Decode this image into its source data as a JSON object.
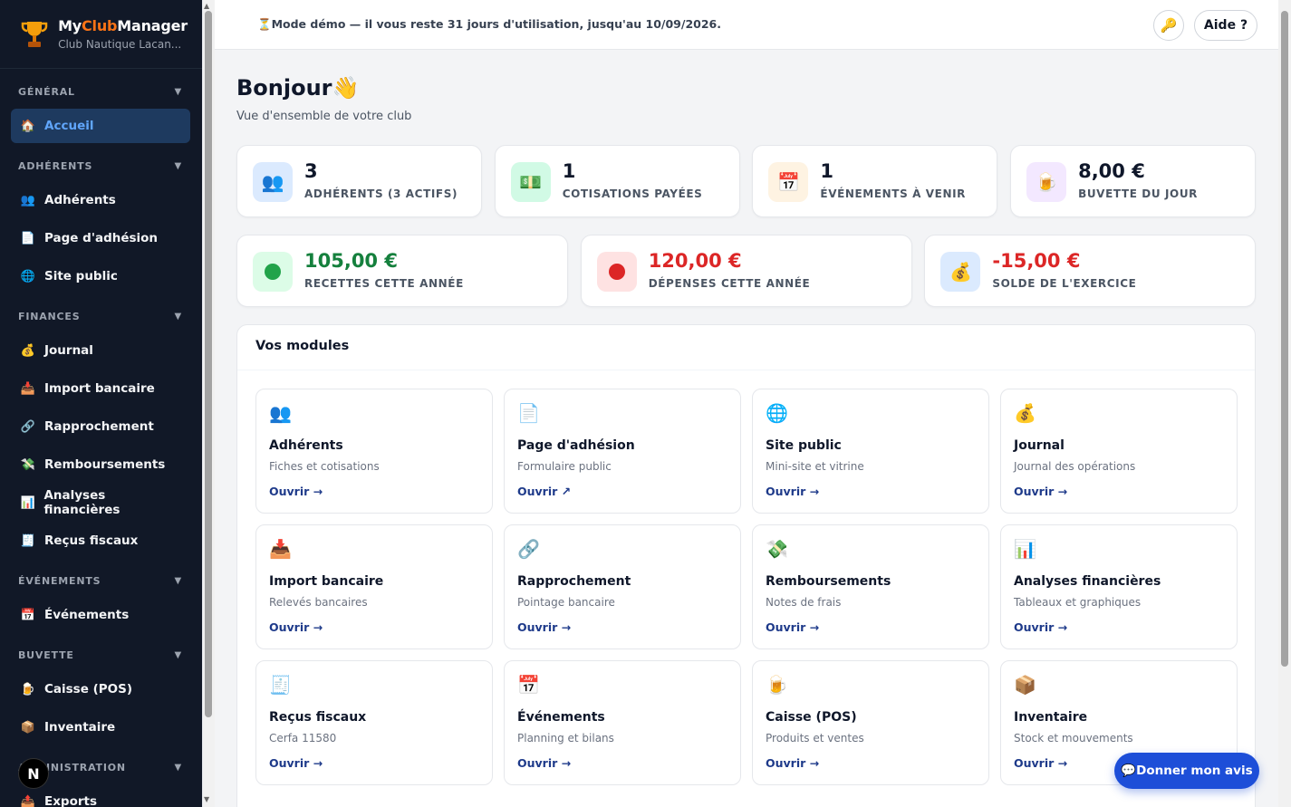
{
  "brand": {
    "name_prefix": "My",
    "name_accent": "Club",
    "name_suffix": "Manager",
    "club": "Club Nautique Lacan...",
    "logo_icon": "trophy-icon"
  },
  "sidebar": {
    "sections": [
      {
        "title": "GÉNÉRAL",
        "items": [
          {
            "label": "Accueil",
            "icon": "🏠",
            "active": true
          }
        ]
      },
      {
        "title": "ADHÉRENTS",
        "items": [
          {
            "label": "Adhérents",
            "icon": "👥"
          },
          {
            "label": "Page d'adhésion",
            "icon": "📄"
          },
          {
            "label": "Site public",
            "icon": "🌐"
          }
        ]
      },
      {
        "title": "FINANCES",
        "items": [
          {
            "label": "Journal",
            "icon": "💰"
          },
          {
            "label": "Import bancaire",
            "icon": "📥"
          },
          {
            "label": "Rapprochement",
            "icon": "🔗"
          },
          {
            "label": "Remboursements",
            "icon": "💸"
          },
          {
            "label": "Analyses financières",
            "icon": "📊"
          },
          {
            "label": "Reçus fiscaux",
            "icon": "🧾"
          }
        ]
      },
      {
        "title": "ÉVÉNEMENTS",
        "items": [
          {
            "label": "Événements",
            "icon": "📅"
          }
        ]
      },
      {
        "title": "BUVETTE",
        "items": [
          {
            "label": "Caisse (POS)",
            "icon": "🍺"
          },
          {
            "label": "Inventaire",
            "icon": "📦"
          }
        ]
      },
      {
        "title": "ADMINISTRATION",
        "items": [
          {
            "label": "Exports",
            "icon": "📤"
          }
        ]
      }
    ],
    "n_badge": "N"
  },
  "topbar": {
    "demo_text": "⏳Mode démo — il vous reste 31 jours d'utilisation, jusqu'au 10/09/2026.",
    "help": "Aide ?"
  },
  "greeting": {
    "title": "Bonjour👋",
    "subtitle": "Vue d'ensemble de votre club"
  },
  "stats_row1": [
    {
      "value": "3",
      "label": "ADHÉRENTS (3 ACTIFS)",
      "icon": "👥",
      "bg": "#dbeafe",
      "color": "#0f172a"
    },
    {
      "value": "1",
      "label": "COTISATIONS PAYÉES",
      "icon": "💵",
      "bg": "#d1fae5",
      "color": "#0f172a"
    },
    {
      "value": "1",
      "label": "ÉVÉNEMENTS À VENIR",
      "icon": "📅",
      "bg": "#fef3e2",
      "color": "#0f172a"
    },
    {
      "value": "8,00 €",
      "label": "BUVETTE DU JOUR",
      "icon": "🍺",
      "bg": "#f3e8ff",
      "color": "#0f172a"
    }
  ],
  "stats_row2": [
    {
      "value": "105,00 €",
      "label": "RECETTES CETTE ANNÉE",
      "icon": "●",
      "bg": "#dcfce7",
      "color": "#15803d",
      "dot": "#22a34a"
    },
    {
      "value": "120,00 €",
      "label": "DÉPENSES CETTE ANNÉE",
      "icon": "●",
      "bg": "#fee2e2",
      "color": "#dc2626",
      "dot": "#dc2626"
    },
    {
      "value": "-15,00 €",
      "label": "SOLDE DE L'EXERCICE",
      "icon": "💰",
      "bg": "#dbeafe",
      "color": "#dc2626"
    }
  ],
  "modules": {
    "title": "Vos modules",
    "items": [
      {
        "title": "Adhérents",
        "desc": "Fiches et cotisations",
        "link": "Ouvrir →",
        "icon": "👥"
      },
      {
        "title": "Page d'adhésion",
        "desc": "Formulaire public",
        "link": "Ouvrir ↗",
        "icon": "📄"
      },
      {
        "title": "Site public",
        "desc": "Mini-site et vitrine",
        "link": "Ouvrir →",
        "icon": "🌐"
      },
      {
        "title": "Journal",
        "desc": "Journal des opérations",
        "link": "Ouvrir →",
        "icon": "💰"
      },
      {
        "title": "Import bancaire",
        "desc": "Relevés bancaires",
        "link": "Ouvrir →",
        "icon": "📥"
      },
      {
        "title": "Rapprochement",
        "desc": "Pointage bancaire",
        "link": "Ouvrir →",
        "icon": "🔗"
      },
      {
        "title": "Remboursements",
        "desc": "Notes de frais",
        "link": "Ouvrir →",
        "icon": "💸"
      },
      {
        "title": "Analyses financières",
        "desc": "Tableaux et graphiques",
        "link": "Ouvrir →",
        "icon": "📊"
      },
      {
        "title": "Reçus fiscaux",
        "desc": "Cerfa 11580",
        "link": "Ouvrir →",
        "icon": "🧾"
      },
      {
        "title": "Événements",
        "desc": "Planning et bilans",
        "link": "Ouvrir →",
        "icon": "📅"
      },
      {
        "title": "Caisse (POS)",
        "desc": "Produits et ventes",
        "link": "Ouvrir →",
        "icon": "🍺"
      },
      {
        "title": "Inventaire",
        "desc": "Stock et mouvements",
        "link": "Ouvrir →",
        "icon": "📦"
      }
    ]
  },
  "feedback": "💬Donner mon avis"
}
